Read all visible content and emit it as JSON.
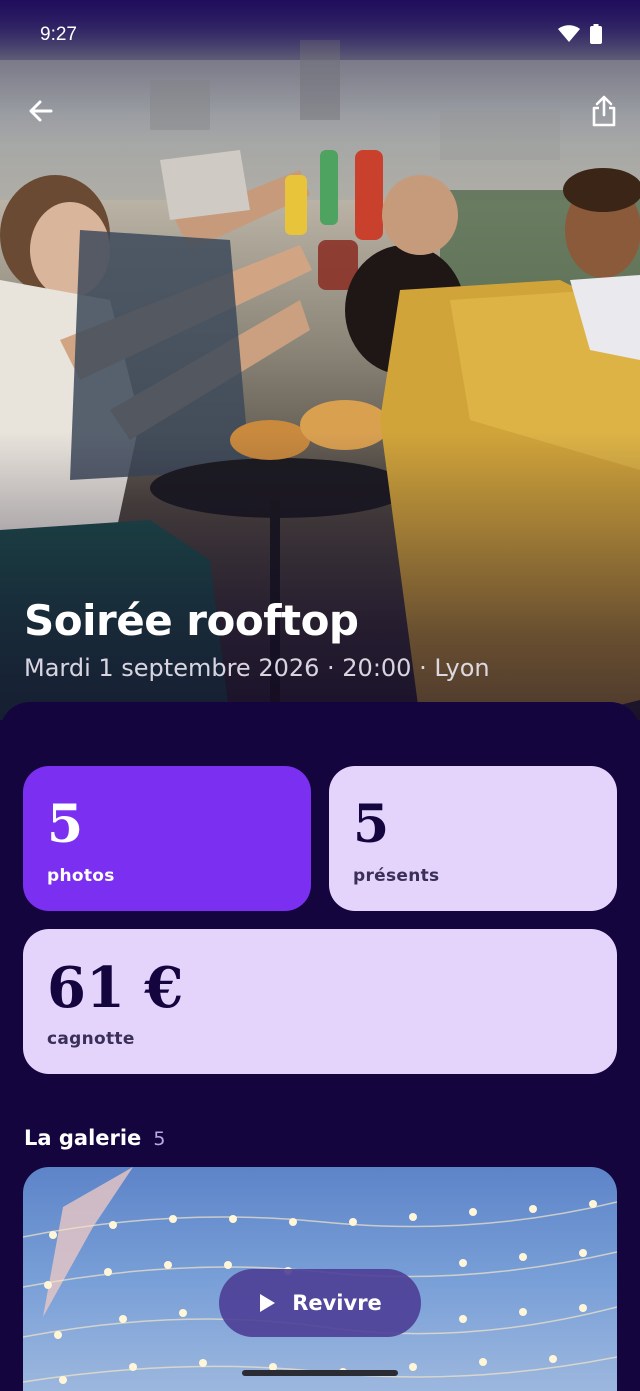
{
  "status_bar": {
    "time": "9:27"
  },
  "header": {
    "back_icon": "arrow-left-icon",
    "share_icon": "share-icon"
  },
  "event": {
    "title": "Soirée rooftop",
    "subtitle": "Mardi 1 septembre 2026 · 20:00 · Lyon"
  },
  "stats": {
    "photos": {
      "value": "5",
      "label": "photos"
    },
    "present": {
      "value": "5",
      "label": "présents"
    },
    "pot": {
      "value": "61 €",
      "label": "cagnotte"
    }
  },
  "gallery": {
    "title": "La galerie",
    "count": "5",
    "replay_label": "Revivre"
  },
  "colors": {
    "background": "#15053f",
    "accent_purple": "#7b2ff0",
    "card_lilac": "#e4d4fc",
    "replay_button": "#4c3e96"
  }
}
